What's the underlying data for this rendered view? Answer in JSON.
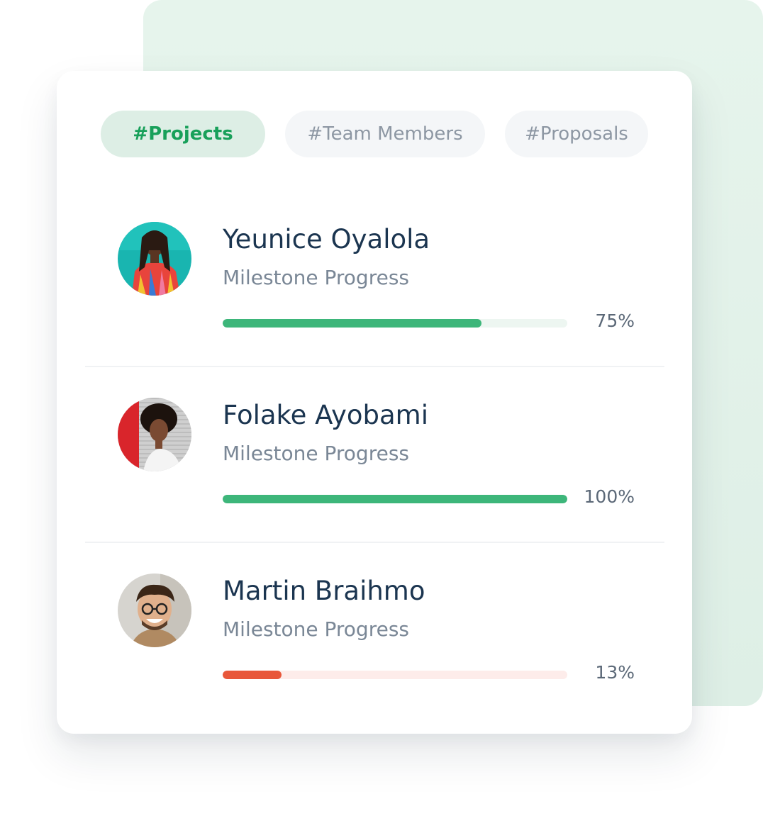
{
  "tabs": [
    {
      "label": "#Projects",
      "active": true
    },
    {
      "label": "#Team Members",
      "active": false
    },
    {
      "label": "#Proposals",
      "active": false
    }
  ],
  "members": [
    {
      "name": "Yeunice Oyalola",
      "subtitle": "Milestone Progress",
      "progress_label": "75%",
      "progress": 0.75,
      "bar_color": "#3db67a",
      "track_color": "#edf6f1"
    },
    {
      "name": "Folake Ayobami",
      "subtitle": "Milestone Progress",
      "progress_label": "100%",
      "progress": 1.0,
      "bar_color": "#3db67a",
      "track_color": "#edf6f1"
    },
    {
      "name": "Martin Braihmo",
      "subtitle": "Milestone Progress",
      "progress_label": "13%",
      "progress": 0.17,
      "bar_color": "#e8573a",
      "track_color": "#fdecea"
    }
  ],
  "colors": {
    "accent": "#18a05a",
    "background_panel": "#e3f3ea",
    "name_text": "#1b3550"
  }
}
